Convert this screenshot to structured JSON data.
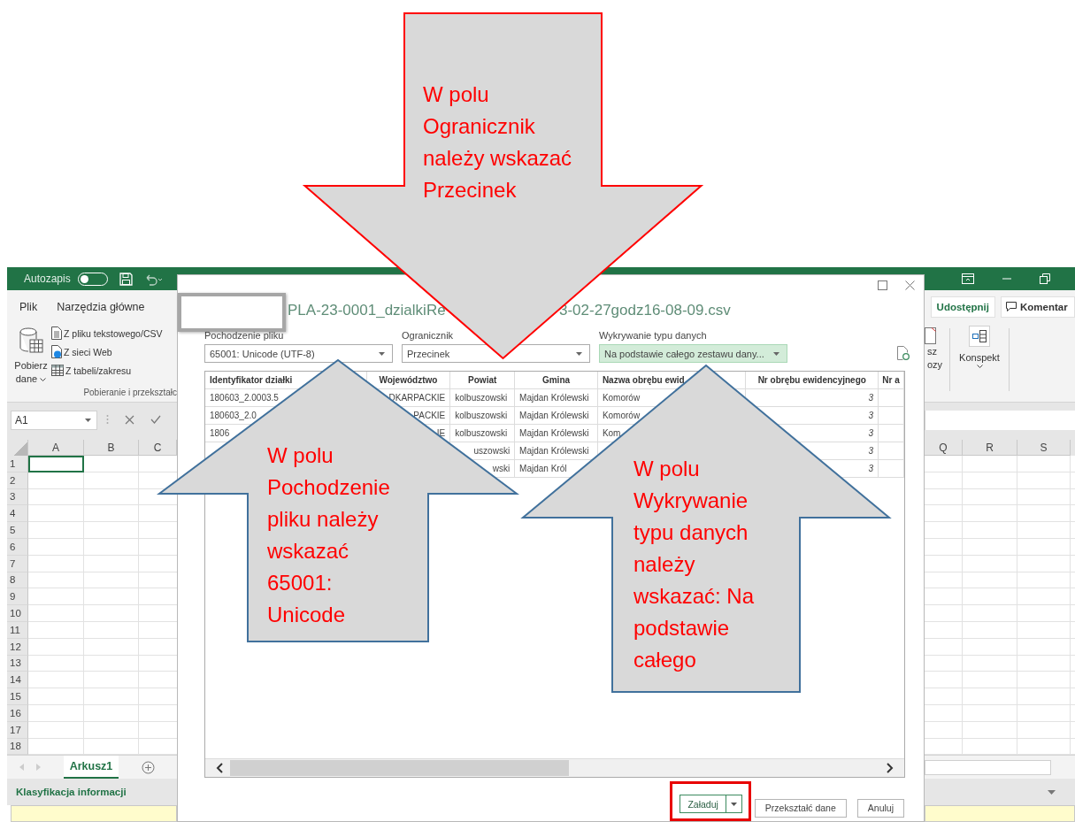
{
  "excel": {
    "title_bar": {
      "autosave_label": "Autozapis",
      "autosave_on": false
    },
    "ribbon_tabs": [
      "Plik",
      "Narzędzia główne"
    ],
    "share_button": "Udostępnij",
    "comments_button": "Komentar",
    "get_data": {
      "button": "Pobierz dane",
      "commands": [
        {
          "label": "Z pliku tekstowego/CSV",
          "kind": "text-file"
        },
        {
          "label": "Z sieci Web",
          "kind": "web"
        },
        {
          "label": "Z tabeli/zakresu",
          "kind": "table"
        }
      ],
      "group_label": "Pobieranie i przekształc"
    },
    "partial_group": [
      "sz",
      "ozy"
    ],
    "outline_button": "Konspekt",
    "name_box": "A1",
    "columns_left": [
      "A",
      "B",
      "C"
    ],
    "columns_right": [
      "Q",
      "R",
      "S"
    ],
    "rows": [
      "1",
      "2",
      "3",
      "4",
      "5",
      "6",
      "7",
      "8",
      "9",
      "10",
      "11",
      "12",
      "13",
      "14",
      "15",
      "16",
      "17",
      "18"
    ],
    "sheet_tabs": [
      {
        "label": "Arkusz1",
        "selected": true
      }
    ],
    "info_bar": "Klasyfikacja informacji"
  },
  "dialog": {
    "title_left": "PLA-23-0001_dzialkiRe",
    "title_right": "3-02-27godz16-08-09.csv",
    "fields": [
      {
        "label": "Pochodzenie pliku",
        "value": "65001: Unicode (UTF-8)",
        "focused": false
      },
      {
        "label": "Ogranicznik",
        "value": "Przecinek",
        "focused": false
      },
      {
        "label": "Wykrywanie typu danych",
        "value": "Na podstawie całego zestawu dany...",
        "focused": true
      }
    ],
    "table": {
      "columns": [
        "Identyfikator działki",
        "Województwo",
        "Powiat",
        "Gmina",
        "Nazwa obrębu ewid",
        "Nr obrębu ewidencyjnego",
        "Nr a"
      ],
      "rows": [
        [
          {
            "kind": "text",
            "text": "180603_2.0003.5",
            "cut_left": false
          },
          {
            "kind": "text",
            "text": "DKARPACKIE",
            "cut_left": true
          },
          {
            "kind": "text",
            "text": "kolbuszowski",
            "cut_left": false
          },
          {
            "kind": "text",
            "text": "Majdan Królewski",
            "cut_left": false
          },
          {
            "kind": "text",
            "text": "Komorów",
            "cut_left": false
          },
          {
            "kind": "number",
            "text": "3"
          },
          null
        ],
        [
          {
            "kind": "text",
            "text": "180603_2.0",
            "cut_left": false
          },
          {
            "kind": "text",
            "text": "PACKIE",
            "cut_left": true
          },
          {
            "kind": "text",
            "text": "kolbuszowski",
            "cut_left": false
          },
          {
            "kind": "text",
            "text": "Majdan Królewski",
            "cut_left": false
          },
          {
            "kind": "text",
            "text": "Komorów",
            "cut_left": false
          },
          {
            "kind": "number",
            "text": "3"
          },
          null
        ],
        [
          {
            "kind": "text",
            "text": "1806",
            "cut_left": false
          },
          {
            "kind": "text",
            "text": "IE",
            "cut_left": true
          },
          {
            "kind": "text",
            "text": "kolbuszowski",
            "cut_left": false
          },
          {
            "kind": "text",
            "text": "Majdan Królewski",
            "cut_left": false
          },
          {
            "kind": "text",
            "text": "Kom",
            "cut_left": false
          },
          {
            "kind": "number",
            "text": "3"
          },
          null
        ],
        [
          null,
          null,
          {
            "kind": "text",
            "text": "uszowski",
            "cut_left": true
          },
          {
            "kind": "text",
            "text": "Majdan Królewski",
            "cut_left": false
          },
          null,
          {
            "kind": "number",
            "text": "3"
          },
          null
        ],
        [
          null,
          null,
          {
            "kind": "text",
            "text": "wski",
            "cut_left": true
          },
          {
            "kind": "text",
            "text": "Majdan Król",
            "cut_left": false
          },
          null,
          {
            "kind": "number",
            "text": "3"
          },
          null
        ]
      ]
    },
    "buttons": [
      {
        "label": "Załaduj",
        "kind": "split",
        "highlighted": true
      },
      {
        "label": "Przekształć dane",
        "kind": "plain",
        "highlighted": false
      },
      {
        "label": "Anuluj",
        "kind": "plain",
        "highlighted": false
      }
    ]
  },
  "annotations": [
    {
      "kind": "arrow-down",
      "color": "#ff0000",
      "text": "W polu Ogranicznik należy wskazać Przecinek"
    },
    {
      "kind": "arrow-up",
      "color": "#41719c",
      "text": "W polu Pochodzenie pliku należy wskazać 65001: Unicode"
    },
    {
      "kind": "arrow-up",
      "color": "#41719c",
      "text": "W polu Wykrywanie typu danych należy wskazać: Na podstawie całego"
    }
  ]
}
